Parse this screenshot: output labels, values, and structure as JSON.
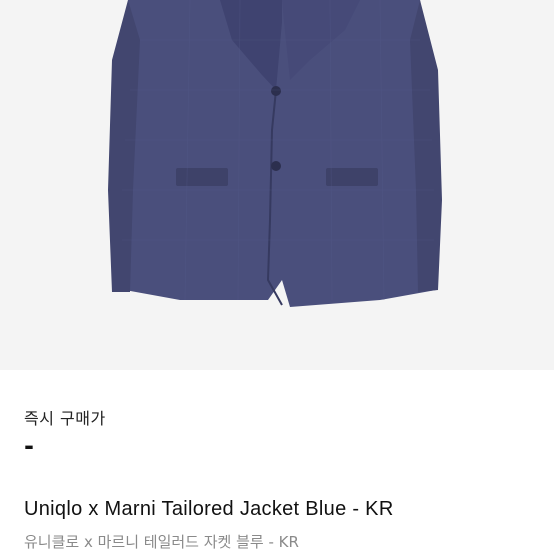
{
  "product": {
    "image_alt": "Uniqlo x Marni Tailored Jacket Blue",
    "price_label": "즉시 구매가",
    "price_value": "-",
    "title": "Uniqlo x Marni Tailored Jacket Blue - KR",
    "subtitle": "유니클로 x 마르니 테일러드 자켓 블루 - KR"
  },
  "colors": {
    "jacket": "#4a4f7c",
    "jacket_dark": "#3b3f66",
    "background": "#f4f4f4"
  }
}
